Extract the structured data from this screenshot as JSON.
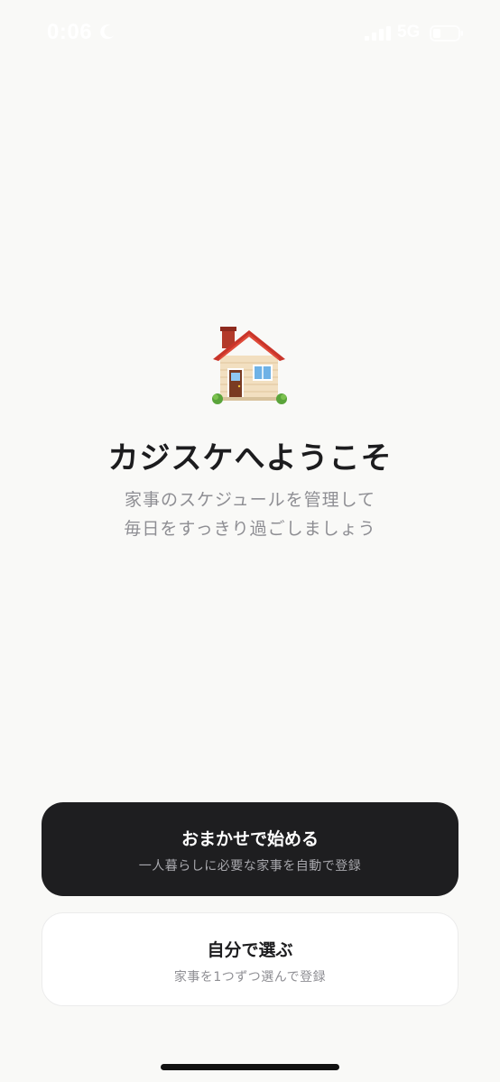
{
  "status_bar": {
    "time": "0:06",
    "network": "5G",
    "icons": [
      "moon-icon",
      "signal-icon",
      "battery-icon"
    ]
  },
  "welcome": {
    "icon": "house-icon",
    "title": "カジスケへようこそ",
    "description_line1": "家事のスケジュールを管理して",
    "description_line2": "毎日をすっきり過ごしましょう"
  },
  "actions": {
    "auto": {
      "title": "おまかせで始める",
      "subtitle": "一人暮らしに必要な家事を自動で登録"
    },
    "manual": {
      "title": "自分で選ぶ",
      "subtitle": "家事を1つずつ選んで登録"
    }
  },
  "colors": {
    "background": "#f9f9f7",
    "primary_button": "#1e1e20",
    "secondary_button": "#ffffff",
    "title_text": "#1c1c1e",
    "secondary_text": "#8e8e93"
  }
}
